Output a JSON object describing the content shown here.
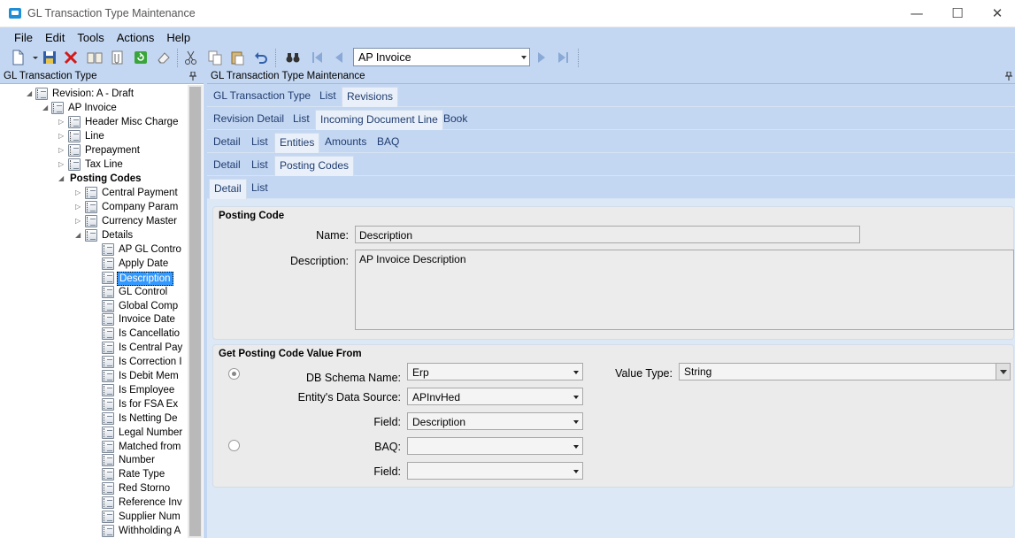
{
  "window": {
    "title": "GL Transaction Type Maintenance"
  },
  "menu": [
    "File",
    "Edit",
    "Tools",
    "Actions",
    "Help"
  ],
  "toolbar": {
    "combo_value": "AP Invoice"
  },
  "left_panel": {
    "title": "GL Transaction Type",
    "tree": [
      {
        "label": "Revision: A - Draft",
        "depth": 0,
        "expander": "open"
      },
      {
        "label": "AP Invoice",
        "depth": 1,
        "expander": "open"
      },
      {
        "label": "Header Misc Charge",
        "depth": 2,
        "expander": "closed"
      },
      {
        "label": "Line",
        "depth": 2,
        "expander": "closed"
      },
      {
        "label": "Prepayment",
        "depth": 2,
        "expander": "closed"
      },
      {
        "label": "Tax Line",
        "depth": 2,
        "expander": "closed"
      },
      {
        "label": "Posting Codes",
        "depth": 2,
        "expander": "open",
        "bold": true,
        "no_icon": true
      },
      {
        "label": "Central Payment",
        "depth": 3,
        "expander": "closed"
      },
      {
        "label": "Company Param",
        "depth": 3,
        "expander": "closed"
      },
      {
        "label": "Currency Master",
        "depth": 3,
        "expander": "closed"
      },
      {
        "label": "Details",
        "depth": 3,
        "expander": "open"
      },
      {
        "label": "AP GL Contro",
        "depth": 4
      },
      {
        "label": "Apply Date",
        "depth": 4
      },
      {
        "label": "Description",
        "depth": 4,
        "selected": true
      },
      {
        "label": "GL Control",
        "depth": 4
      },
      {
        "label": "Global Comp",
        "depth": 4
      },
      {
        "label": "Invoice Date",
        "depth": 4
      },
      {
        "label": "Is Cancellatio",
        "depth": 4
      },
      {
        "label": "Is Central Pay",
        "depth": 4
      },
      {
        "label": "Is Correction I",
        "depth": 4
      },
      {
        "label": "Is Debit Mem",
        "depth": 4
      },
      {
        "label": "Is Employee",
        "depth": 4
      },
      {
        "label": "Is for FSA Ex",
        "depth": 4
      },
      {
        "label": "Is Netting De",
        "depth": 4
      },
      {
        "label": "Legal Number",
        "depth": 4
      },
      {
        "label": "Matched from",
        "depth": 4
      },
      {
        "label": "Number",
        "depth": 4
      },
      {
        "label": "Rate Type",
        "depth": 4
      },
      {
        "label": "Red Storno",
        "depth": 4
      },
      {
        "label": "Reference Inv",
        "depth": 4
      },
      {
        "label": "Supplier Num",
        "depth": 4
      },
      {
        "label": "Withholding A",
        "depth": 4
      }
    ]
  },
  "right_panel": {
    "title": "GL Transaction Type Maintenance",
    "tab_rows": [
      [
        {
          "label": "GL Transaction Type"
        },
        {
          "label": "List"
        },
        {
          "label": "Revisions",
          "active": true
        }
      ],
      [
        {
          "label": "Revision Detail"
        },
        {
          "label": "List"
        },
        {
          "label": "Incoming Document Line",
          "active": true
        },
        {
          "label": "Book"
        }
      ],
      [
        {
          "label": "Detail"
        },
        {
          "label": "List"
        },
        {
          "label": "Entities",
          "active": true
        },
        {
          "label": "Amounts"
        },
        {
          "label": "BAQ"
        }
      ],
      [
        {
          "label": "Detail"
        },
        {
          "label": "List"
        },
        {
          "label": "Posting Codes",
          "active": true
        }
      ],
      [
        {
          "label": "Detail",
          "active": true
        },
        {
          "label": "List"
        }
      ]
    ],
    "posting_code": {
      "group_title": "Posting Code",
      "name_label": "Name:",
      "name_value": "Description",
      "description_label": "Description:",
      "description_value": "AP Invoice Description"
    },
    "get_value": {
      "group_title": "Get Posting Code Value From",
      "db_schema_label": "DB Schema Name:",
      "db_schema_value": "Erp",
      "entity_source_label": "Entity's Data Source:",
      "entity_source_value": "APInvHed",
      "field_label": "Field:",
      "field_value": "Description",
      "baq_label": "BAQ:",
      "baq_value": "",
      "baq_field_label": "Field:",
      "baq_field_value": "",
      "value_type_label": "Value Type:",
      "value_type_value": "String",
      "source_selected": "entity"
    }
  },
  "colors": {
    "chrome": "#c4d7f2",
    "panel_bg": "#dde8f6",
    "selection": "#3399ff"
  }
}
